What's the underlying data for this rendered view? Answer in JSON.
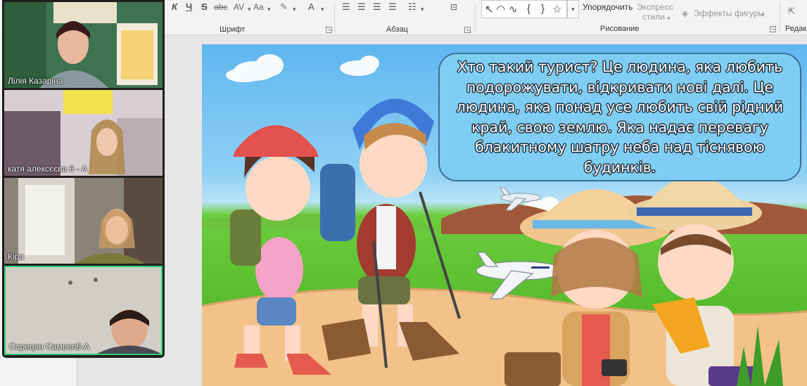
{
  "ribbon": {
    "groups": {
      "font": "Шрифт",
      "paragraph": "Абзац",
      "drawing": "Рисование",
      "editing": "Редак"
    },
    "font_buttons": {
      "italic": "К",
      "underline": "Ч",
      "strike": "S",
      "abc": "abc",
      "spacing": "AV",
      "case": "Aa",
      "font_color": "A"
    },
    "drawing": {
      "arrange": "Упорядочить",
      "quick_styles_line1": "Экспресс",
      "quick_styles_line2": "стили",
      "shape_effects": "Эффекты фигуры"
    }
  },
  "slide": {
    "speech_text": "Хто такий турист? Це людина, яка любить подорожувати, відкривати нові далі. Це людина, яка понад усе любить свій рідний край, свою землю. Яка надає перевагу блакитному шатру неба над тіснявою будинків."
  },
  "participants": [
    {
      "name": "Лілія Казаріна",
      "active": false
    },
    {
      "name": "катя алексєєва 6 - А",
      "active": false
    },
    {
      "name": "Кіра",
      "active": false
    },
    {
      "name": "Сарецян Самвел6-А",
      "active": true
    }
  ],
  "colors": {
    "active_speaker": "#2bd47a",
    "speech_bubble": "#7fcdf3",
    "speech_border": "#3b6f98"
  }
}
